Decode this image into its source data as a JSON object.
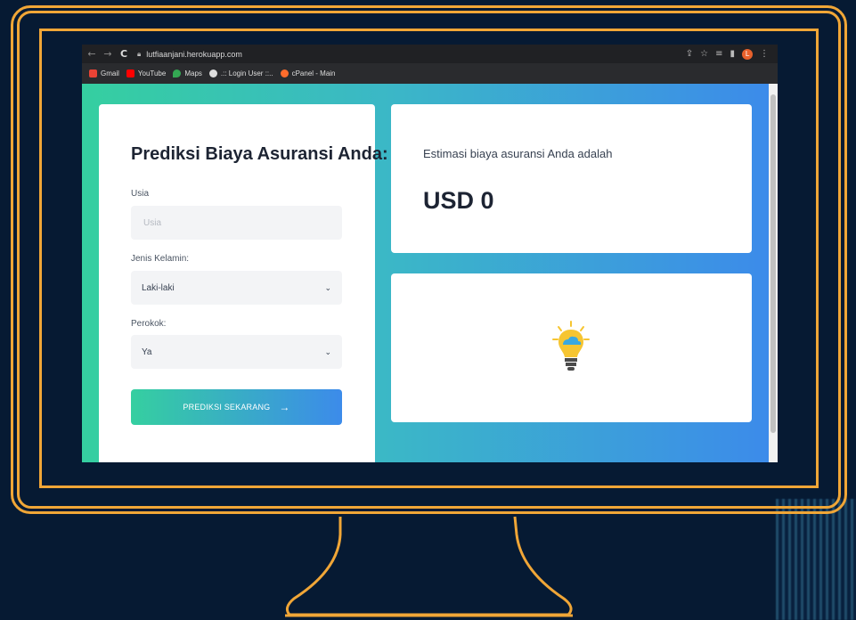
{
  "browser": {
    "url": "lutfiaanjani.herokuapp.com",
    "profile_initial": "L",
    "bookmarks": [
      {
        "label": "Gmail",
        "color": "#ea4335"
      },
      {
        "label": "YouTube",
        "color": "#ff0000"
      },
      {
        "label": "Maps",
        "color": "#34a853"
      },
      {
        "label": ".:: Login User ::..",
        "color": "#dddddd"
      },
      {
        "label": "cPanel - Main",
        "color": "#ff6c2c"
      }
    ]
  },
  "form": {
    "title": "Prediksi Biaya Asuransi Anda:",
    "age_label": "Usia",
    "age_placeholder": "Usia",
    "gender_label": "Jenis Kelamin:",
    "gender_value": "Laki-laki",
    "smoker_label": "Perokok:",
    "smoker_value": "Ya",
    "submit_label": "PREDIKSI SEKARANG"
  },
  "result": {
    "label": "Estimasi biaya asuransi Anda adalah",
    "value": "USD 0"
  },
  "colors": {
    "frame": "#f0a637",
    "gradient_start": "#35cfa0",
    "gradient_end": "#3c8bea",
    "background": "#061a33"
  }
}
